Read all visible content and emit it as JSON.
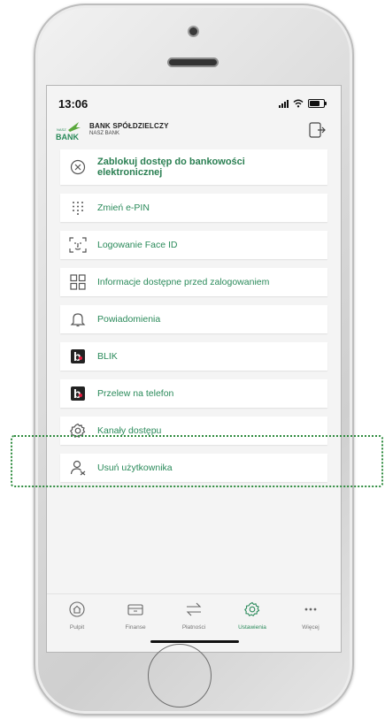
{
  "status": {
    "time": "13:06"
  },
  "bank": {
    "logo_small": "NASZ",
    "logo_word": "BANK",
    "name": "BANK SPÓŁDZIELCZY",
    "subname": "NASZ BANK"
  },
  "menu": [
    {
      "label": "Zablokuj dostęp do bankowości elektronicznej",
      "icon": "block-circle-icon"
    },
    {
      "label": "Zmień e-PIN",
      "icon": "keypad-icon"
    },
    {
      "label": "Logowanie Face ID",
      "icon": "face-id-icon"
    },
    {
      "label": "Informacje dostępne przed zalogowaniem",
      "icon": "grid-icon"
    },
    {
      "label": "Powiadomienia",
      "icon": "bell-icon"
    },
    {
      "label": "BLIK",
      "icon": "blik-icon"
    },
    {
      "label": "Przelew na telefon",
      "icon": "blik-icon"
    },
    {
      "label": "Kanały dostępu",
      "icon": "gear-icon"
    },
    {
      "label": "Usuń użytkownika",
      "icon": "remove-user-icon"
    }
  ],
  "tabs": [
    {
      "label": "Pulpit",
      "icon": "home-icon"
    },
    {
      "label": "Finanse",
      "icon": "wallet-icon"
    },
    {
      "label": "Płatności",
      "icon": "transfer-arrows-icon"
    },
    {
      "label": "Ustawienia",
      "icon": "gear-icon",
      "active": true
    },
    {
      "label": "Więcej",
      "icon": "more-dots-icon"
    }
  ],
  "colors": {
    "accent": "#2a8a5a",
    "highlight": "#2e8b3e",
    "blik_dot": "#e3183c"
  }
}
